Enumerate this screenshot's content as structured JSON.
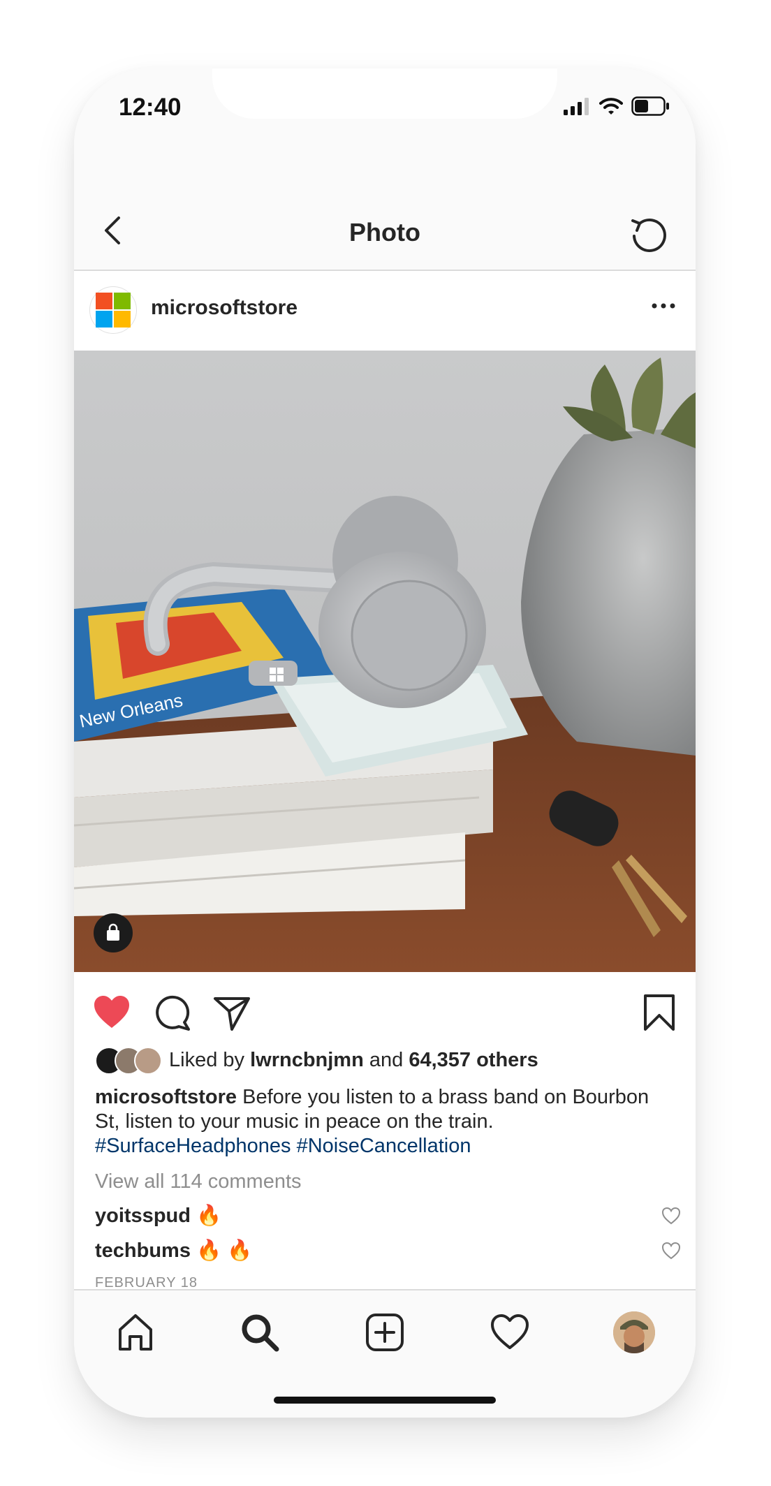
{
  "status_bar": {
    "time": "12:40"
  },
  "nav": {
    "title": "Photo"
  },
  "post": {
    "username": "microsoftstore",
    "liked": {
      "prefix": "Liked by",
      "user": "lwrncbnjmn",
      "connector": "and",
      "others": "64,357 others"
    },
    "caption": {
      "author": "microsoftstore",
      "text": "Before you listen to a brass band on Bourbon St, listen to your music in peace on the train.",
      "hashtags": "#SurfaceHeadphones #NoiseCancellation"
    },
    "view_comments": "View all 114 comments",
    "comments": [
      {
        "user": "yoitsspud",
        "text": "🔥"
      },
      {
        "user": "techbums",
        "text": "🔥 🔥"
      }
    ],
    "date": "FEBRUARY 18",
    "photo_label": "New Orleans",
    "liked_state": true
  },
  "colors": {
    "like_red": "#ed4956",
    "link_blue": "#003569",
    "ms_red": "#f25022",
    "ms_green": "#7fba00",
    "ms_blue": "#00a4ef",
    "ms_yellow": "#ffb900"
  },
  "icons": {
    "header": [
      "back-arrow-icon",
      "refresh-icon",
      "more-options-icon"
    ],
    "actions": [
      "heart-icon",
      "comment-icon",
      "share-icon",
      "bookmark-icon"
    ],
    "tabs": [
      "home-icon",
      "search-icon",
      "new-post-icon",
      "activity-heart-icon",
      "profile-avatar"
    ]
  }
}
